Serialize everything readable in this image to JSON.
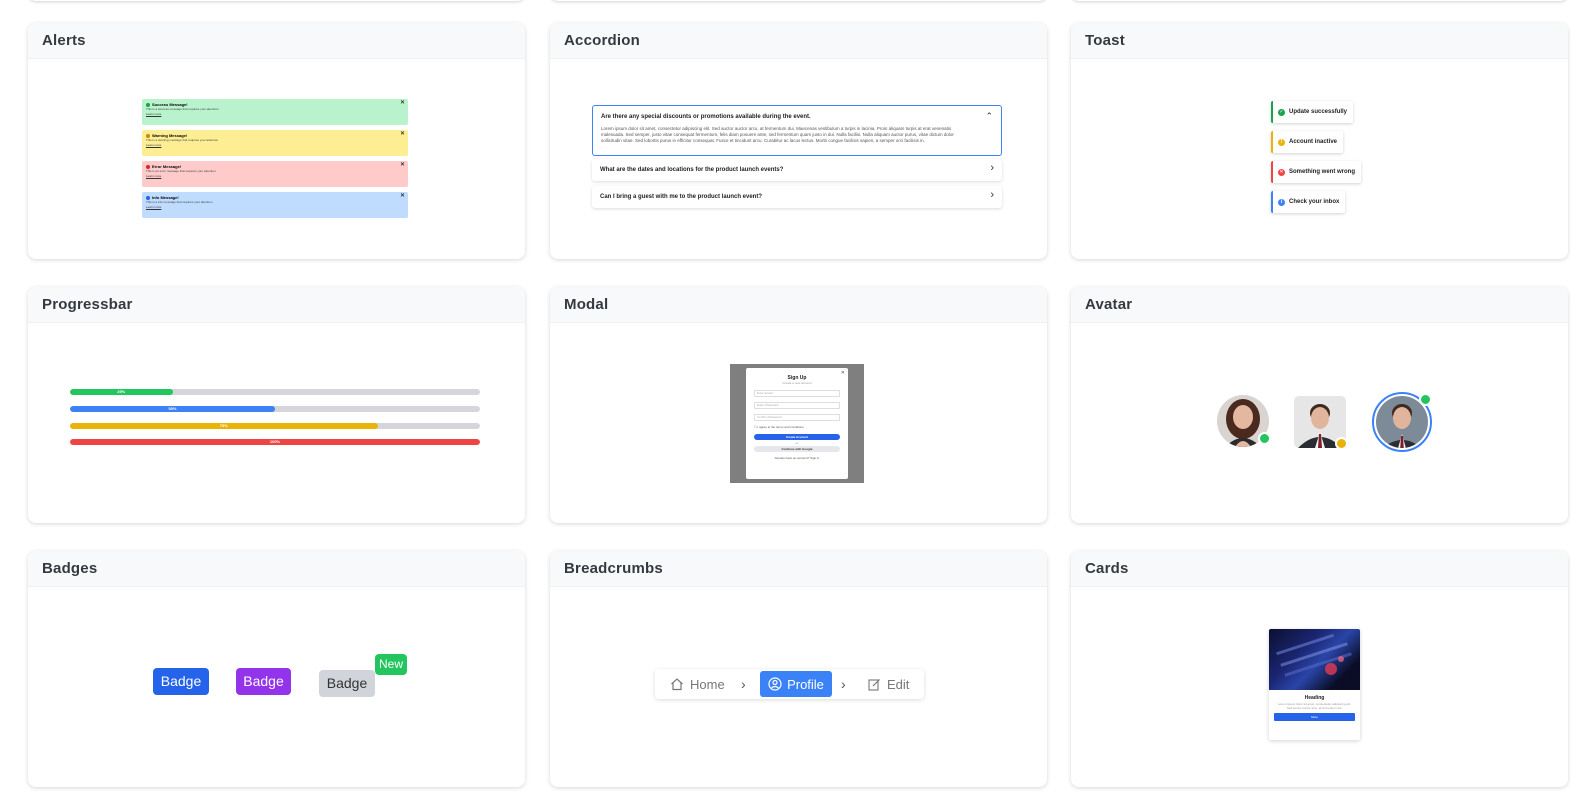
{
  "cards": {
    "alerts": {
      "title": "Alerts",
      "items": [
        {
          "title": "Success Message!",
          "text": "This is a success message that requires your attention.",
          "link": "Learn more",
          "close": "✕",
          "bg": "#b9f3cd",
          "accent": "#16a34a"
        },
        {
          "title": "Warning Message!",
          "text": "This is a warning message that requires your attention.",
          "link": "Learn more",
          "close": "✕",
          "bg": "#fdee93",
          "accent": "#ca8a04"
        },
        {
          "title": "Error Message!",
          "text": "This is an error message that requires your attention.",
          "link": "Learn more",
          "close": "✕",
          "bg": "#fecaca",
          "accent": "#dc2626"
        },
        {
          "title": "Info Message!",
          "text": "This is a info message that requires your attention.",
          "link": "Learn more",
          "close": "✕",
          "bg": "#bfdbfe",
          "accent": "#2563eb"
        }
      ]
    },
    "accordion": {
      "title": "Accordion",
      "open_question": "Are there any special discounts or promotions available during the event.",
      "open_answer": "Lorem ipsum dolor sit amet, consectetur adipiscing elit. Sed auctor auctor arcu, at fermentum dui. Maecenas vestibulum a turpis in lacinia. Proin aliquam turpis at erat venenatis malesuada. Sed semper, justo vitae consequat fermentum, felis diam posuere ante, sed fermentum quam justo in dui. Nulla facilisi. Nulla aliquam auctor purus, vitae dictum dolor sollicitudin vitae. Sed lobortis purus in efficitur consequat. Fusce et tincidunt arcu. Curabitur ac lacus lectus. Morbi congue facilisis sapien, a semper orci facilisis in.",
      "open_chevron": "⌃",
      "collapsed": [
        {
          "question": "What are the dates and locations for the product launch events?",
          "chevron": "›"
        },
        {
          "question": "Can I bring a guest with me to the product launch event?",
          "chevron": "›"
        }
      ]
    },
    "toast": {
      "title": "Toast",
      "items": [
        {
          "text": "Update successfully",
          "icon": "✓",
          "color": "#16a34a"
        },
        {
          "text": "Account inactive",
          "icon": "!",
          "color": "#eab308"
        },
        {
          "text": "Something went wrong",
          "icon": "✕",
          "color": "#ef4444"
        },
        {
          "text": "Check your inbox",
          "icon": "i",
          "color": "#3b82f6"
        }
      ]
    },
    "progressbar": {
      "title": "Progressbar",
      "bars": [
        {
          "label": "25%",
          "value": 0.25,
          "color": "#22c55e"
        },
        {
          "label": "50%",
          "value": 0.5,
          "color": "#3b82f6"
        },
        {
          "label": "75%",
          "value": 0.75,
          "color": "#eab308"
        },
        {
          "label": "100%",
          "value": 1.0,
          "color": "#ef4444"
        }
      ]
    },
    "modal": {
      "title": "Modal",
      "dialog_title": "Sign Up",
      "dialog_subtitle": "Create a new account",
      "close": "✕",
      "fields": [
        "Enter Email",
        "Enter Password",
        "Confirm Password"
      ],
      "checkbox_label": "I agree to the terms and conditions",
      "primary_button": "Create Account",
      "or_text": "or",
      "google_button": "Continue with Google",
      "footer_text": "Already have an account? Sign in"
    },
    "avatar": {
      "title": "Avatar",
      "items": [
        {
          "shape": "circle",
          "status_color": "#22c55e"
        },
        {
          "shape": "rounded",
          "status_color": "#eab308"
        },
        {
          "shape": "ring",
          "status_color": "#22c55e"
        }
      ]
    },
    "badges": {
      "title": "Badges",
      "items": [
        {
          "label": "Badge",
          "bg": "#2563eb",
          "color": "#ffffff"
        },
        {
          "label": "Badge",
          "bg": "#9333ea",
          "color": "#ffffff"
        },
        {
          "label": "Badge",
          "bg": "#d1d5db",
          "color": "#333333"
        }
      ],
      "new_label": "New"
    },
    "breadcrumbs": {
      "title": "Breadcrumbs",
      "home": "Home",
      "profile": "Profile",
      "edit": "Edit",
      "separator": "›"
    },
    "cards": {
      "title": "Cards",
      "heading": "Heading",
      "text": "Lorem ipsum dolor sit amet, consectetur adipiscing elit. Sed auctor auctor arcu, at fermentum dui.",
      "button": "More"
    }
  }
}
